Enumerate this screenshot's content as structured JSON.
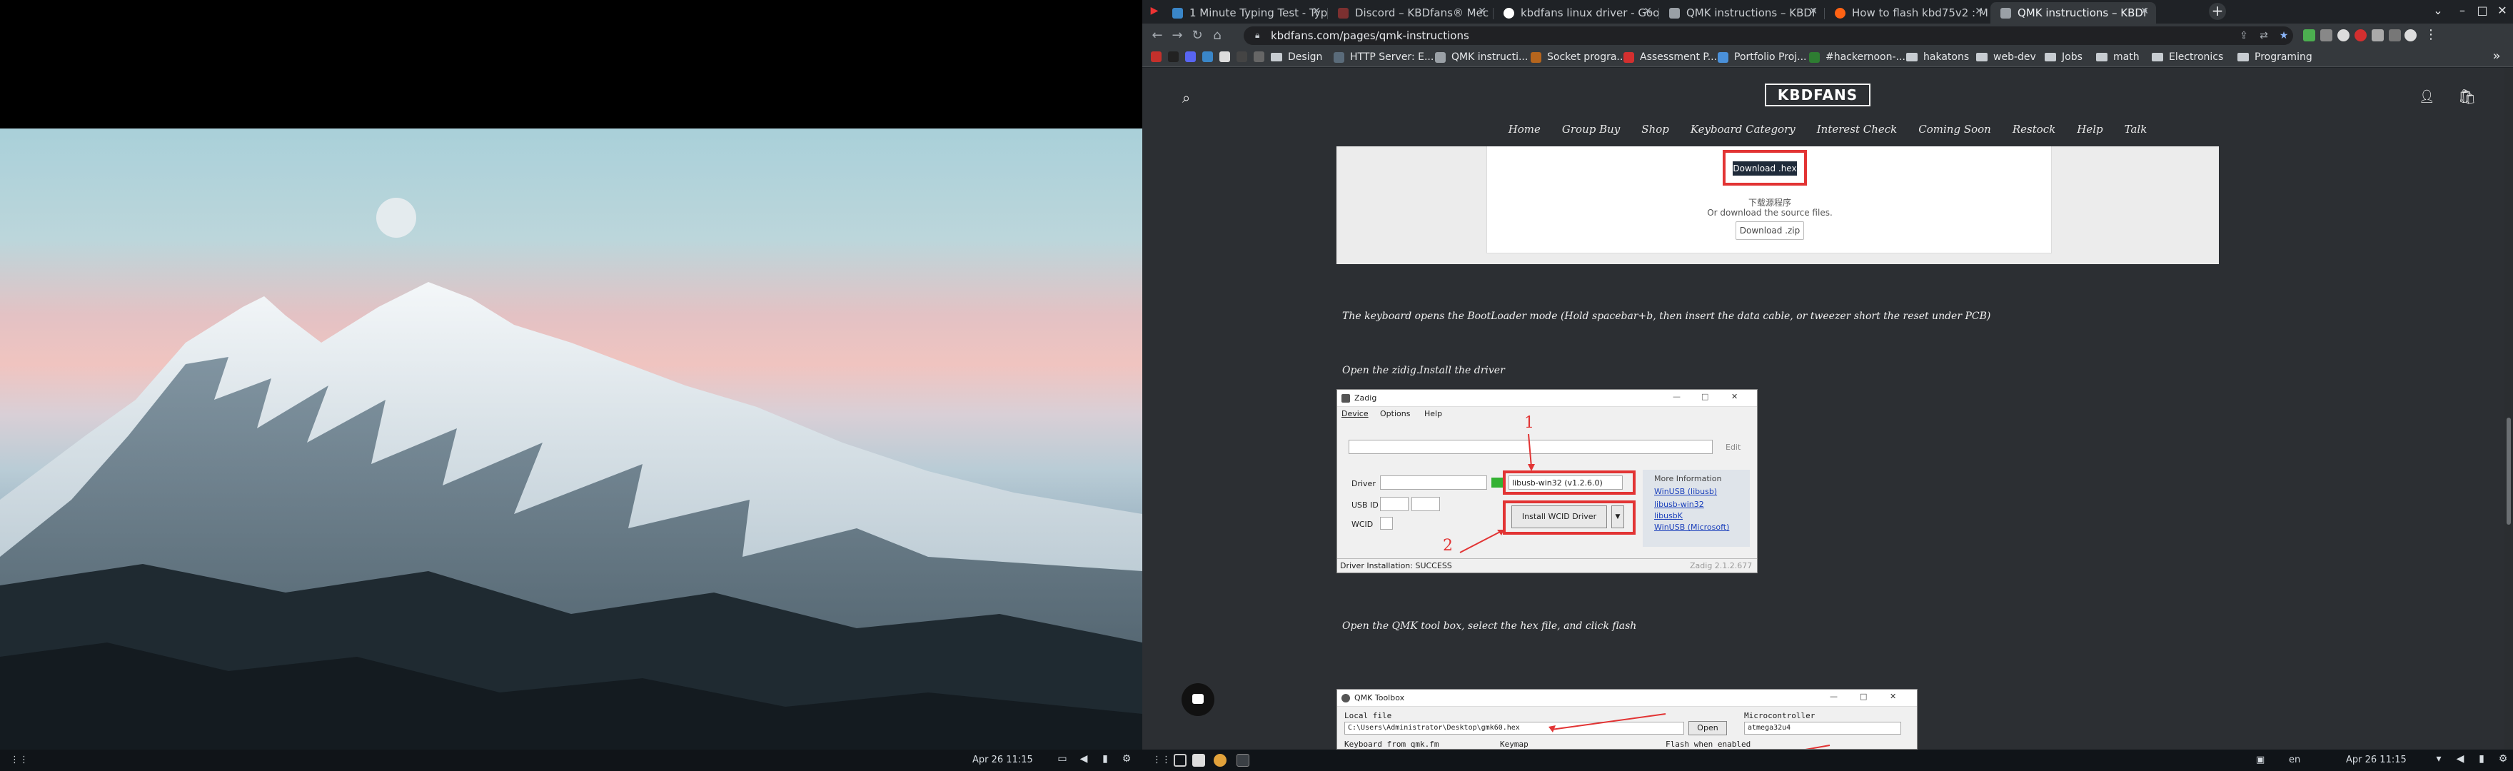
{
  "desktop": {
    "clock": "Apr 26  11:15"
  },
  "browser": {
    "tabs": [
      {
        "label": "1 Minute Typing Test - Typ",
        "favicon_color": "#3a86c8"
      },
      {
        "label": "Discord – KBDfans® Mec",
        "favicon_color": "#7c3030"
      },
      {
        "label": "kbdfans linux driver - Goo",
        "favicon_color": "#ffffff"
      },
      {
        "label": "QMK instructions – KBDf",
        "favicon_color": "#9aa0a6"
      },
      {
        "label": "How to flash kbd75v2 : M",
        "favicon_color": "#ff6314"
      },
      {
        "label": "QMK instructions – KBDf",
        "favicon_color": "#9aa0a6"
      }
    ],
    "url": "kbdfans.com/pages/qmk-instructions",
    "bookmarks": [
      {
        "label": "Design",
        "type": "folder"
      },
      {
        "label": "HTTP Server: E...",
        "type": "link"
      },
      {
        "label": "QMK instructi...",
        "type": "link"
      },
      {
        "label": "Socket progra...",
        "type": "link"
      },
      {
        "label": "Assessment P...",
        "type": "link"
      },
      {
        "label": "Portfolio Proj...",
        "type": "link"
      },
      {
        "label": "#hackernoon-...",
        "type": "link"
      },
      {
        "label": "hakatons",
        "type": "folder"
      },
      {
        "label": "web-dev",
        "type": "folder"
      },
      {
        "label": "Jobs",
        "type": "folder"
      },
      {
        "label": "math",
        "type": "folder"
      },
      {
        "label": "Electronics",
        "type": "folder"
      },
      {
        "label": "Programing",
        "type": "folder"
      }
    ]
  },
  "site": {
    "logo": "KBDFANS",
    "nav": [
      "Home",
      "Group Buy",
      "Shop",
      "Keyboard Category",
      "Interest Check",
      "Coming Soon",
      "Restock",
      "Help",
      "Talk"
    ],
    "download_hex": "Download .hex",
    "download_cn": "下载源程序",
    "or_download_source": "Or download the source files.",
    "download_zip": "Download .zip",
    "para_bootloader": "The keyboard opens the BootLoader mode   (Hold spacebar+b, then insert the data cable, or tweezer short the reset under PCB)",
    "para_zadig": "Open the zidig.Install the driver",
    "para_qmk": "Open the QMK tool box, select the hex file, and click flash"
  },
  "zadig": {
    "title": "Zadig",
    "menu": [
      "Device",
      "Options",
      "Help"
    ],
    "edit": "Edit",
    "driver_label": "Driver",
    "driver_value": "libusb-win32 (v1.2.6.0)",
    "usbid_label": "USB ID",
    "wcid_label": "WCID",
    "install_button": "Install WCID Driver",
    "more_info": "More Information",
    "links": [
      "WinUSB (libusb)",
      "libusb-win32",
      "libusbK",
      "WinUSB (Microsoft)"
    ],
    "status": "Driver Installation: SUCCESS",
    "version": "Zadig 2.1.2.677",
    "marker1": "1",
    "marker2": "2"
  },
  "qmk": {
    "title": "QMK Toolbox",
    "local_file_label": "Local file",
    "local_file_value": "C:\\Users\\Administrator\\Desktop\\gmk60.hex",
    "open_button": "Open",
    "mcu_label": "Microcontroller",
    "mcu_value": "atmega32u4",
    "keyboard_label": "Keyboard from qmk.fm",
    "keymap_label": "Keymap",
    "flash_label": "Flash when enabled"
  },
  "taskbar": {
    "lang": "en",
    "clock": "Apr 26  11:15"
  }
}
